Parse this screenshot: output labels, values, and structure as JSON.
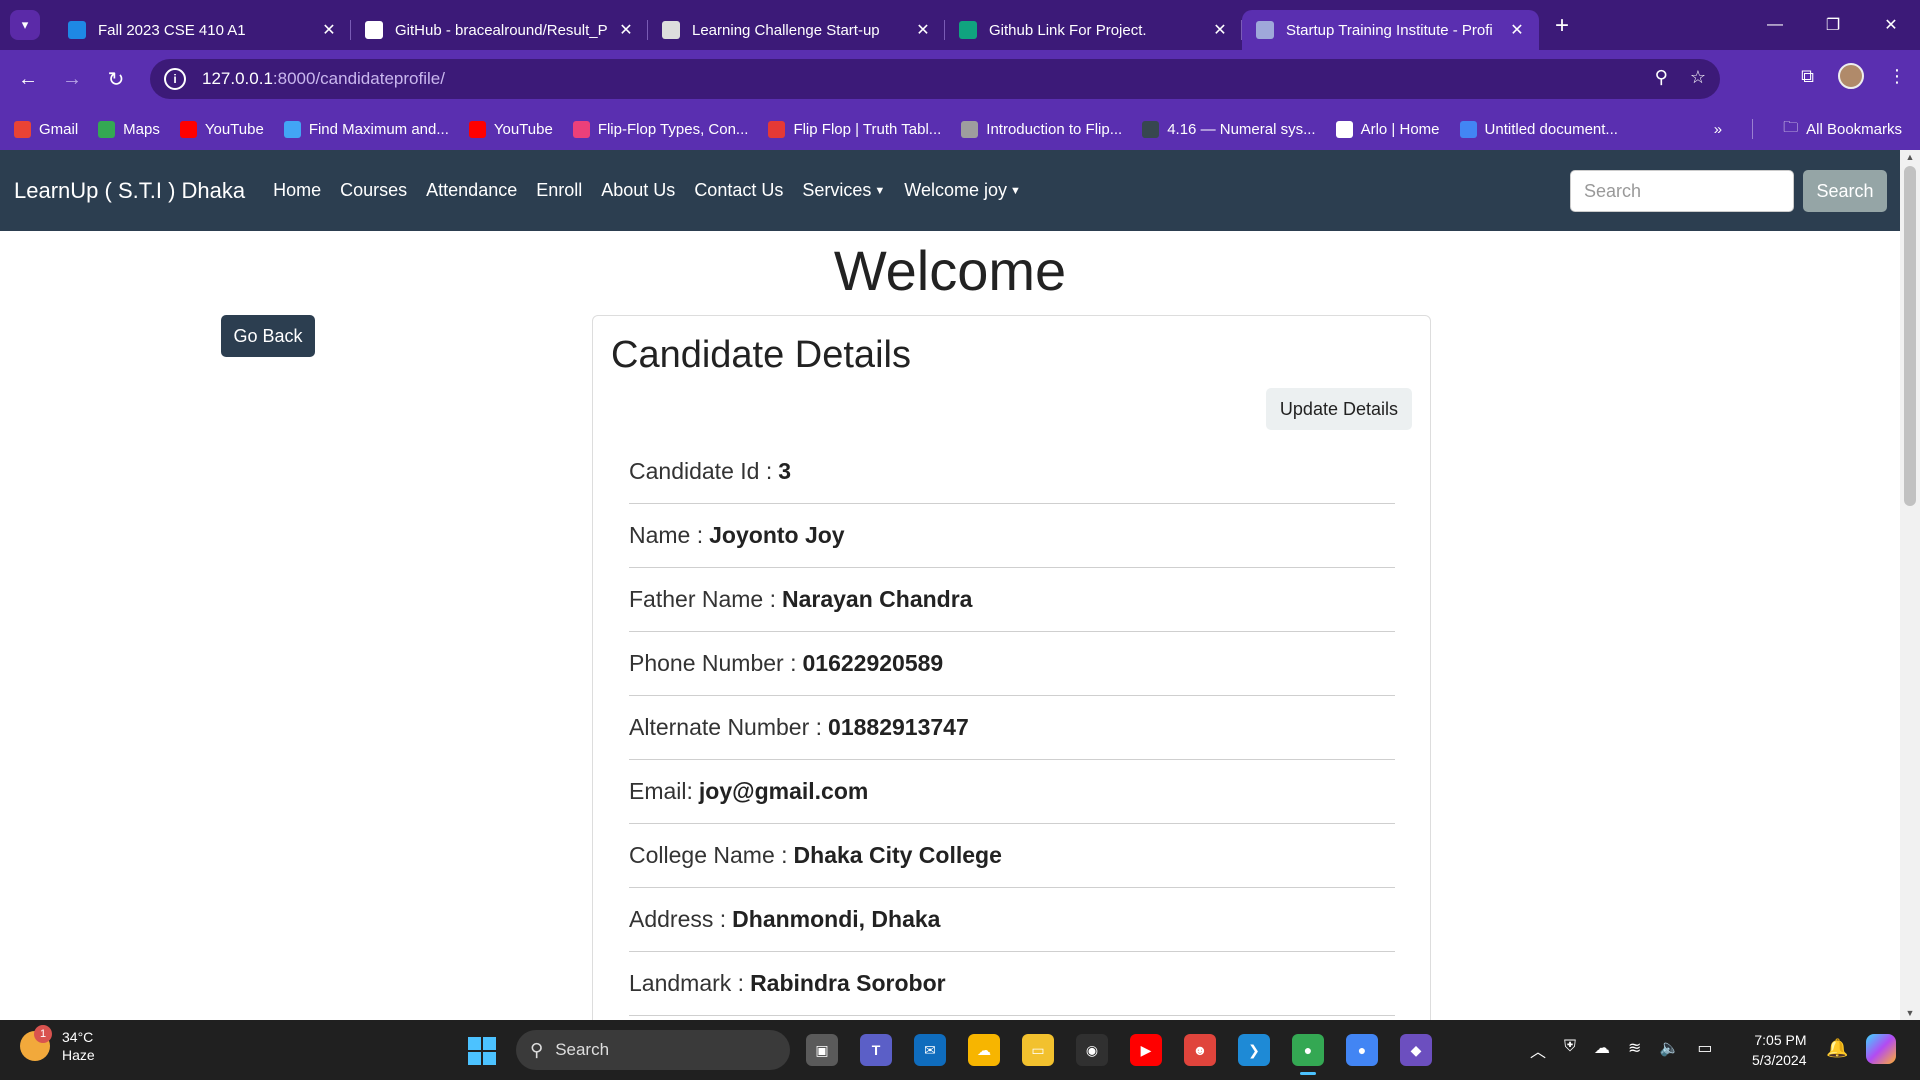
{
  "browser": {
    "tabs": [
      {
        "title": "Fall 2023 CSE 410 A1",
        "icon": "classroom-icon",
        "color": "#1e88e5",
        "active": false
      },
      {
        "title": "GitHub - bracealround/Result_P",
        "icon": "github-icon",
        "color": "#ffffff",
        "active": false
      },
      {
        "title": "Learning Challenge Start-up",
        "icon": "link-icon",
        "color": "#dddddd",
        "active": false
      },
      {
        "title": "Github Link For Project.",
        "icon": "chatgpt-icon",
        "color": "#10a37f",
        "active": false
      },
      {
        "title": "Startup Training Institute - Profi",
        "icon": "globe-icon",
        "color": "#9fa8da",
        "active": true
      }
    ],
    "url_host": "127.0.0.1",
    "url_path": ":8000/candidateprofile/",
    "bookmarks": [
      {
        "label": "Gmail",
        "icon": "gmail-icon",
        "color": "#ea4335"
      },
      {
        "label": "Maps",
        "icon": "maps-icon",
        "color": "#34a853"
      },
      {
        "label": "YouTube",
        "icon": "youtube-icon",
        "color": "#ff0000"
      },
      {
        "label": "Find Maximum and...",
        "icon": "j-icon",
        "color": "#42a5f5"
      },
      {
        "label": "YouTube",
        "icon": "youtube-icon",
        "color": "#ff0000"
      },
      {
        "label": "Flip-Flop Types, Con...",
        "icon": "bookmark-icon",
        "color": "#ec407a"
      },
      {
        "label": "Flip Flop | Truth Tabl...",
        "icon": "sigma-icon",
        "color": "#e53935"
      },
      {
        "label": "Introduction to Flip...",
        "icon": "shield-icon",
        "color": "#9e9e9e"
      },
      {
        "label": "4.16 — Numeral sys...",
        "icon": "book-icon",
        "color": "#37474f"
      },
      {
        "label": "Arlo | Home",
        "icon": "globe-icon",
        "color": "#ffffff"
      },
      {
        "label": "Untitled document...",
        "icon": "docs-icon",
        "color": "#4285f4"
      }
    ],
    "all_bookmarks": "All Bookmarks"
  },
  "site": {
    "brand": "LearnUp ( S.T.I ) Dhaka",
    "nav": [
      "Home",
      "Courses",
      "Attendance",
      "Enroll",
      "About Us",
      "Contact Us"
    ],
    "services": "Services",
    "welcome_user": "Welcome joy",
    "search_placeholder": "Search",
    "search_button": "Search"
  },
  "main": {
    "heading": "Welcome",
    "go_back": "Go Back",
    "card_title": "Candidate Details",
    "update_button": "Update Details",
    "fields": [
      {
        "label": "Candidate Id :",
        "value": "3"
      },
      {
        "label": "Name :",
        "value": "Joyonto Joy"
      },
      {
        "label": "Father Name :",
        "value": "Narayan Chandra"
      },
      {
        "label": "Phone Number :",
        "value": "01622920589"
      },
      {
        "label": "Alternate Number :",
        "value": "01882913747"
      },
      {
        "label": "Email:",
        "value": "joy@gmail.com"
      },
      {
        "label": "College Name :",
        "value": "Dhaka City College"
      },
      {
        "label": "Address :",
        "value": "Dhanmondi, Dhaka"
      },
      {
        "label": "Landmark :",
        "value": "Rabindra Sorobor"
      }
    ]
  },
  "taskbar": {
    "temperature": "34°C",
    "weather": "Haze",
    "notification_count": "1",
    "search": "Search",
    "time": "7:05 PM",
    "date": "5/3/2024",
    "apps": [
      {
        "name": "task-view-icon",
        "color": "#5a5a5a",
        "glyph": "▣"
      },
      {
        "name": "teams-icon",
        "color": "#5b5fc7",
        "glyph": "T"
      },
      {
        "name": "mail-icon",
        "color": "#0f6cbd",
        "glyph": "✉"
      },
      {
        "name": "weather-app-icon",
        "color": "#f7b500",
        "glyph": "☁"
      },
      {
        "name": "file-explorer-icon",
        "color": "#f2c12e",
        "glyph": "▭"
      },
      {
        "name": "obs-icon",
        "color": "#303030",
        "glyph": "◉"
      },
      {
        "name": "youtube-app-icon",
        "color": "#ff0000",
        "glyph": "▶"
      },
      {
        "name": "game-icon",
        "color": "#e0443c",
        "glyph": "☻"
      },
      {
        "name": "vscode-icon",
        "color": "#1e8ad6",
        "glyph": "❯"
      },
      {
        "name": "chrome-icon",
        "color": "#34a853",
        "glyph": "●",
        "active": true
      },
      {
        "name": "chrome-profile-icon",
        "color": "#4285f4",
        "glyph": "●"
      },
      {
        "name": "git-icon",
        "color": "#6c4fbf",
        "glyph": "◆"
      }
    ]
  }
}
